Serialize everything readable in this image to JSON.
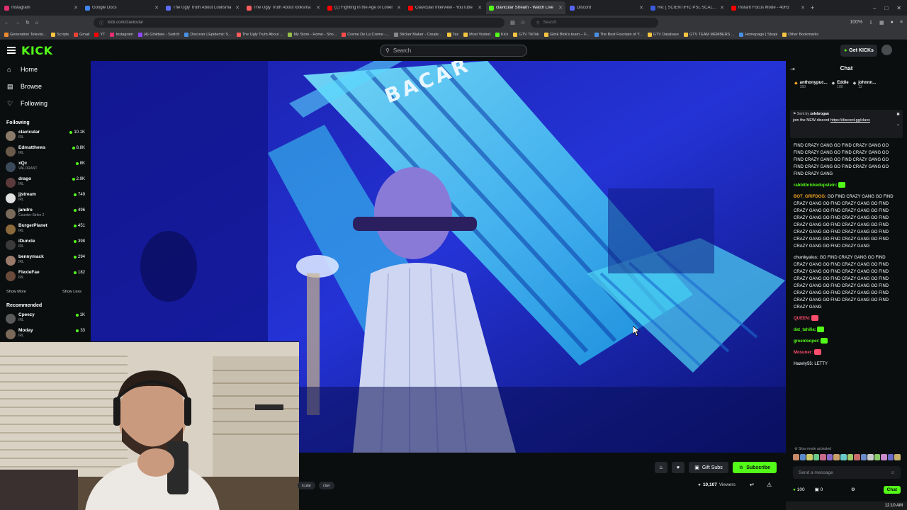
{
  "browser": {
    "tabs": [
      {
        "title": "Instagram",
        "color": "#e1306c"
      },
      {
        "title": "Google Docs",
        "color": "#4285f4"
      },
      {
        "title": "The Ugly Truth About Looksma",
        "color": "#5b6cff"
      },
      {
        "title": "The Ugly Truth About looksma",
        "color": "#ff5c5c"
      },
      {
        "title": "(1) Fighting in the Age of Lonel",
        "color": "#ff0000"
      },
      {
        "title": "Clavicular Interview - YouTube",
        "color": "#ff0000"
      },
      {
        "title": "clavicular Stream - Watch Live",
        "color": "#53fc18",
        "active": true
      },
      {
        "title": "Discord",
        "color": "#5865f2"
      },
      {
        "title": "Re: [ SCIENTIFIC PSL SCALE CH",
        "color": "#3b5bdb"
      },
      {
        "title": "Instant Focus Mode - 40Hz",
        "color": "#ff0000"
      }
    ],
    "url": "kick.com/clavicular",
    "omni_placeholder": "Search",
    "zoom": "100%",
    "bookmarks": [
      {
        "label": "Generation Televisi...",
        "color": "#f08c2e"
      },
      {
        "label": "Scripts",
        "color": "#f5c542"
      },
      {
        "label": "Gmail",
        "color": "#ea4335"
      },
      {
        "label": "YT",
        "color": "#ff0000"
      },
      {
        "label": "Instagram",
        "color": "#e1306c"
      },
      {
        "label": "(4) Glnktwie - Switch",
        "color": "#9147ff"
      },
      {
        "label": "Discover | Epidemic S...",
        "color": "#4a90e2"
      },
      {
        "label": "The Ugly Truth About ...",
        "color": "#ff5c5c"
      },
      {
        "label": "My Store - Home - Sho...",
        "color": "#95bf47"
      },
      {
        "label": "Creme De La Creme -...",
        "color": "#ff4d4d"
      },
      {
        "label": "Sticker Maker - Create...",
        "color": "#888888"
      },
      {
        "label": "Tax",
        "color": "#f5c542"
      },
      {
        "label": "Most Visited",
        "color": "#f5c542"
      },
      {
        "label": "Kick",
        "color": "#53fc18"
      },
      {
        "label": "GTV TikTok",
        "color": "#f5c542"
      },
      {
        "label": "Glink Blok's team – F...",
        "color": "#f5c542"
      },
      {
        "label": "The Best Fountain of Y...",
        "color": "#4a90e2"
      },
      {
        "label": "GTV Database",
        "color": "#f5c542"
      },
      {
        "label": "GTV TEAM MEMBERS ...",
        "color": "#f5c542"
      },
      {
        "label": "Homepage | Strapi",
        "color": "#4a90e2"
      },
      {
        "label": "Other Bookmarks",
        "color": "#f5c542"
      }
    ]
  },
  "header": {
    "logo": "KICK",
    "search_placeholder": "Search",
    "get_kicks": "Get KICKs"
  },
  "sidebar": {
    "nav": [
      {
        "label": "Home",
        "icon": "home-icon"
      },
      {
        "label": "Browse",
        "icon": "browse-icon"
      },
      {
        "label": "Following",
        "icon": "heart-icon"
      }
    ],
    "following_title": "Following",
    "following": [
      {
        "name": "clavicular",
        "category": "IRL",
        "viewers": "10.1K",
        "color": "#8a7a6a"
      },
      {
        "name": "Edmatthews",
        "category": "IRL",
        "viewers": "8.8K",
        "color": "#6a5a4a"
      },
      {
        "name": "xQc",
        "category": "VALORANT",
        "viewers": "8K",
        "color": "#3a4a5a"
      },
      {
        "name": "drago",
        "category": "IRL",
        "viewers": "2.9K",
        "color": "#5a3a3a"
      },
      {
        "name": "jjstream",
        "category": "IRL",
        "viewers": "749",
        "color": "#e0e0e0"
      },
      {
        "name": "jandro",
        "category": "Counter-Strike 2",
        "viewers": "496",
        "color": "#7a6a5a"
      },
      {
        "name": "BurgerPlanet",
        "category": "IRL",
        "viewers": "451",
        "color": "#8a6a3a"
      },
      {
        "name": "iDuncle",
        "category": "IRL",
        "viewers": "398",
        "color": "#3a3a3a"
      },
      {
        "name": "bennymack",
        "category": "IRL",
        "viewers": "294",
        "color": "#9a7a6a"
      },
      {
        "name": "FlexieFae",
        "category": "IRL",
        "viewers": "182",
        "color": "#6a4a3a"
      }
    ],
    "show_more": "Show More",
    "show_less": "Show Less",
    "recommended_title": "Recommended",
    "recommended": [
      {
        "name": "Cpeezy",
        "category": "IRL",
        "viewers": "1K",
        "color": "#5a5a5a"
      },
      {
        "name": "Moday",
        "category": "IRL",
        "viewers": "33",
        "color": "#7a6a5a"
      }
    ]
  },
  "video": {
    "sign_text": "BACAR"
  },
  "stream": {
    "gift_subs": "Gift Subs",
    "subscribe": "Subscribe",
    "tags": [
      "icular",
      "clav"
    ],
    "viewers_count": "10,107",
    "viewers_label": "Viewers"
  },
  "chat": {
    "title": "Chat",
    "leaderboard": [
      {
        "name": "anthonypuc...",
        "value": "150",
        "color": "#f5a623"
      },
      {
        "name": "Eddie",
        "value": "100",
        "color": "#c9cbcf"
      },
      {
        "name": "johnnn...",
        "value": "12",
        "color": "#c9cbcf"
      }
    ],
    "pinned": {
      "sent_by_label": "Sent by",
      "user": "xelebrogan",
      "text": "join the NEW discord",
      "link": "https://discord.gg/clavx"
    },
    "messages": [
      {
        "user": "",
        "color": "#ffffff",
        "text": "FIND CRAZY GANG GO FIND CRAZY GANG GO FIND CRAZY GANG GO FIND CRAZY GANG GO FIND CRAZY GANG GO FIND CRAZY GANG GO FIND CRAZY GANG GO FIND CRAZY GANG GO FIND CRAZY GANG"
      },
      {
        "user": "rabbitbrickedupstein:",
        "color": "#53fc18",
        "text": ""
      },
      {
        "user": "BOT_GRIFDOG:",
        "color": "#f5a623",
        "text": "GO FIND CRAZY GANG GO FIND CRAZY GANG GO FIND CRAZY GANG GO FIND CRAZY GANG GO FIND CRAZY GANG GO FIND CRAZY GANG GO FIND CRAZY GANG GO FIND CRAZY GANG GO FIND CRAZY GANG GO FIND CRAZY GANG GO FIND CRAZY GANG GO FIND CRAZY GANG GO FIND CRAZY GANG GO FIND CRAZY GANG GO FIND CRAZY GANG"
      },
      {
        "user": "chunkyalus:",
        "color": "#c9cbcf",
        "text": "GO FIND CRAZY GANG GO FIND CRAZY GANG GO FIND CRAZY GANG GO FIND CRAZY GANG GO FIND CRAZY GANG GO FIND CRAZY GANG GO FIND CRAZY GANG GO FIND CRAZY GANG GO FIND CRAZY GANG GO FIND CRAZY GANG GO FIND CRAZY GANG GO FIND CRAZY GANG GO FIND CRAZY GANG GO FIND CRAZY GANG"
      },
      {
        "user": "QUEEN:",
        "color": "#ff4d6d",
        "text": ""
      },
      {
        "user": "dat_tahilia:",
        "color": "#53fc18",
        "text": ""
      },
      {
        "user": "greenlooper:",
        "color": "#53fc18",
        "text": ""
      },
      {
        "user": "Mosuner:",
        "color": "#ff4d6d",
        "text": ""
      },
      {
        "user": "Hazely55:",
        "color": "#c9cbcf",
        "text": "LETTY"
      }
    ],
    "slow_mode": "Slow mode activated",
    "input_placeholder": "Send a message",
    "kicks_count": "100",
    "sub_count": "0",
    "send_label": "Chat"
  },
  "taskbar": {
    "time": "12:10 AM"
  },
  "colors": {
    "kick_green": "#53fc18",
    "page_bg": "#0b0e0f",
    "panel_bg": "#191b1f"
  }
}
